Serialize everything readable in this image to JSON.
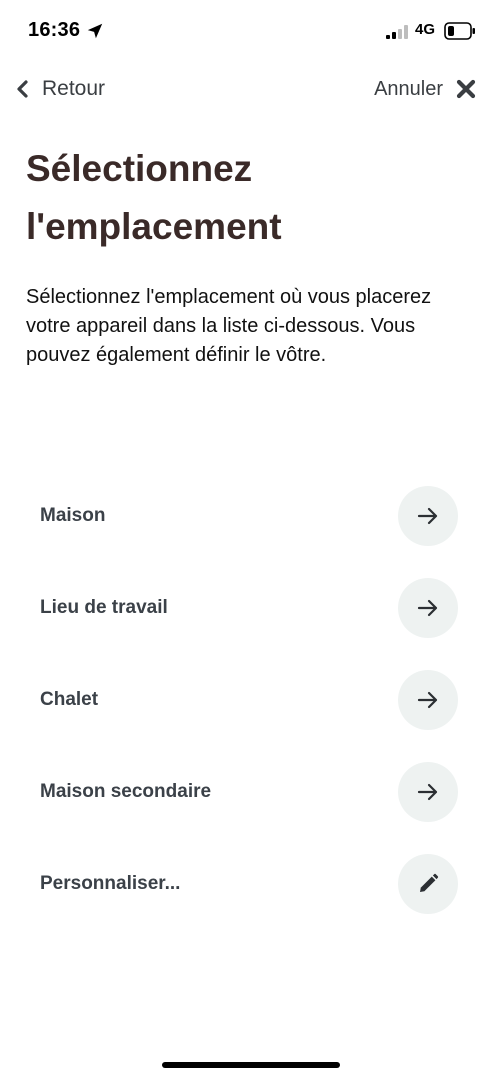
{
  "status_bar": {
    "time": "16:36",
    "network": "4G"
  },
  "nav": {
    "back_label": "Retour",
    "cancel_label": "Annuler"
  },
  "header": {
    "title": "Sélectionnez l'emplacement",
    "description": "Sélectionnez l'emplacement où vous placerez votre appareil dans la liste ci-dessous. Vous pouvez également définir le vôtre."
  },
  "options": [
    {
      "label": "Maison",
      "icon": "arrow-right-icon"
    },
    {
      "label": "Lieu de travail",
      "icon": "arrow-right-icon"
    },
    {
      "label": "Chalet",
      "icon": "arrow-right-icon"
    },
    {
      "label": "Maison secondaire",
      "icon": "arrow-right-icon"
    },
    {
      "label": "Personnaliser...",
      "icon": "pencil-icon"
    }
  ],
  "colors": {
    "title": "#3a2a28",
    "option_text": "#3b4148",
    "action_circle": "#eef2f1"
  }
}
